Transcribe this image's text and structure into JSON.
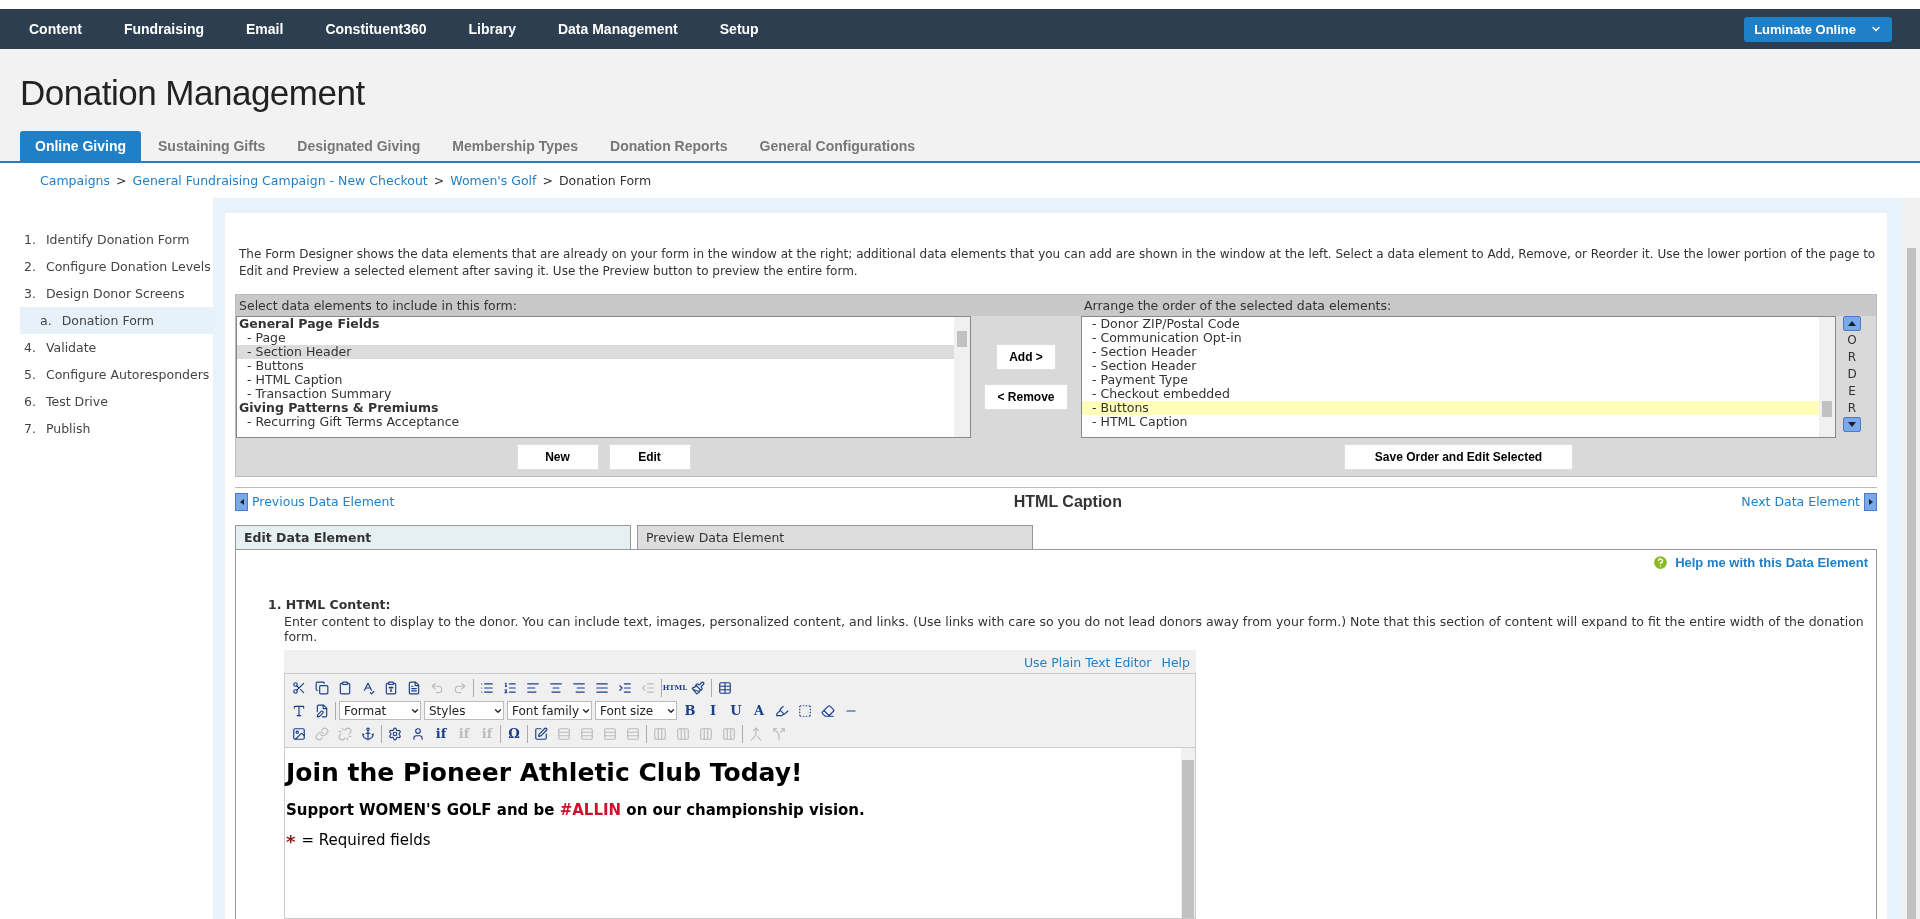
{
  "top_nav": {
    "items": [
      {
        "label": "Content"
      },
      {
        "label": "Fundraising"
      },
      {
        "label": "Email"
      },
      {
        "label": "Constituent360"
      },
      {
        "label": "Library"
      },
      {
        "label": "Data Management"
      },
      {
        "label": "Setup"
      }
    ],
    "product_button": "Luminate Online"
  },
  "page_title": "Donation Management",
  "tabs": [
    {
      "label": "Online Giving",
      "selected": true
    },
    {
      "label": "Sustaining Gifts",
      "selected": false
    },
    {
      "label": "Designated Giving",
      "selected": false
    },
    {
      "label": "Membership Types",
      "selected": false
    },
    {
      "label": "Donation Reports",
      "selected": false
    },
    {
      "label": "General Configurations",
      "selected": false
    }
  ],
  "breadcrumb": {
    "links": [
      "Campaigns",
      "General Fundraising Campaign - New Checkout",
      "Women's Golf"
    ],
    "separator": ">",
    "current": "Donation Form"
  },
  "steps": [
    {
      "number": "1.",
      "label": "Identify Donation Form",
      "selected": false
    },
    {
      "number": "2.",
      "label": "Configure Donation Levels",
      "selected": false
    },
    {
      "number": "3.",
      "label": "Design Donor Screens",
      "selected": false,
      "children": [
        {
          "number": "a.",
          "label": "Donation Form",
          "selected": true
        }
      ]
    },
    {
      "number": "4.",
      "label": "Validate",
      "selected": false
    },
    {
      "number": "5.",
      "label": "Configure Autoresponders",
      "selected": false
    },
    {
      "number": "6.",
      "label": "Test Drive",
      "selected": false
    },
    {
      "number": "7.",
      "label": "Publish",
      "selected": false
    }
  ],
  "intro": "The Form Designer shows the data elements that are already on your form in the window at the right; additional data elements that you can add are shown in the window at the left. Select a data element to Add, Remove, or Reorder it. Use the lower portion of the page to Edit and Preview a selected element after saving it. Use the Preview button to preview the entire form.",
  "available_list": {
    "heading": "Select data elements to include in this form:",
    "items": [
      {
        "kind": "group",
        "label": "General Page Fields",
        "selected": false
      },
      {
        "kind": "item",
        "label": "- Page",
        "selected": false
      },
      {
        "kind": "item",
        "label": "- Section Header",
        "selected": true
      },
      {
        "kind": "item",
        "label": "- Buttons",
        "selected": false
      },
      {
        "kind": "item",
        "label": "- HTML Caption",
        "selected": false
      },
      {
        "kind": "item",
        "label": "- Transaction Summary",
        "selected": false
      },
      {
        "kind": "group",
        "label": "Giving Patterns & Premiums",
        "selected": false
      },
      {
        "kind": "item",
        "label": "- Recurring Gift Terms Acceptance",
        "selected": false
      }
    ],
    "buttons": [
      "New",
      "Edit"
    ]
  },
  "move_buttons": [
    "Add >",
    "< Remove"
  ],
  "selected_list": {
    "heading": "Arrange the order of the selected data elements:",
    "items": [
      {
        "label": "- Donor ZIP/Postal Code",
        "selected": false
      },
      {
        "label": "- Communication Opt-in",
        "selected": false
      },
      {
        "label": "- Section Header",
        "selected": false
      },
      {
        "label": "- Section Header",
        "selected": false
      },
      {
        "label": "- Payment Type",
        "selected": false
      },
      {
        "label": "- Checkout embedded",
        "selected": false
      },
      {
        "label": "- Buttons",
        "selected": true
      },
      {
        "label": "- HTML Caption",
        "selected": false
      }
    ],
    "order_letters": [
      "O",
      "R",
      "D",
      "E",
      "R"
    ],
    "button": "Save Order and Edit Selected"
  },
  "element_nav": {
    "previous": "Previous Data Element",
    "title": "HTML Caption",
    "next": "Next Data Element"
  },
  "element_tabs": [
    {
      "label": "Edit Data Element",
      "selected": true
    },
    {
      "label": "Preview Data Element",
      "selected": false
    }
  ],
  "help_link": "Help me with this Data Element",
  "field": {
    "number": "1.",
    "label": "HTML Content:",
    "description": "Enter content to display to the donor. You can include text, images, personalized content, and links. (Use links with care so you do not lead donors away from your form.) Note that this section of content will expand to fit the entire width of the donation form."
  },
  "editor": {
    "links": [
      "Use Plain Text Editor",
      "Help"
    ],
    "toolbar": [
      [
        {
          "kind": "cut",
          "disabled": false
        },
        {
          "kind": "copy",
          "disabled": false
        },
        {
          "kind": "paste",
          "disabled": false
        },
        {
          "kind": "spell",
          "disabled": false
        },
        {
          "kind": "pastetext",
          "disabled": false
        },
        {
          "kind": "pasteword",
          "disabled": false
        },
        {
          "kind": "undo",
          "disabled": true
        },
        {
          "kind": "redo",
          "disabled": true
        },
        {
          "kind": "sep"
        },
        {
          "kind": "bullets",
          "disabled": false
        },
        {
          "kind": "numbers",
          "disabled": false
        },
        {
          "kind": "left",
          "disabled": false
        },
        {
          "kind": "center",
          "disabled": false
        },
        {
          "kind": "right",
          "disabled": false
        },
        {
          "kind": "justify",
          "disabled": false
        },
        {
          "kind": "indent",
          "disabled": false
        },
        {
          "kind": "outdent",
          "disabled": true
        },
        {
          "kind": "sep"
        },
        {
          "kind": "glyph",
          "label": "HTML",
          "disabled": false
        },
        {
          "kind": "brush",
          "disabled": false
        },
        {
          "kind": "sep"
        },
        {
          "kind": "table",
          "disabled": false
        }
      ],
      [
        {
          "kind": "styles",
          "disabled": false
        },
        {
          "kind": "template",
          "disabled": false
        },
        {
          "kind": "sep"
        },
        {
          "kind": "select",
          "label": "Format"
        },
        {
          "kind": "select",
          "label": "Styles"
        },
        {
          "kind": "select",
          "label": "Font family"
        },
        {
          "kind": "select",
          "label": "Font size"
        },
        {
          "kind": "glyph",
          "label": "B",
          "disabled": false
        },
        {
          "kind": "glyph",
          "label": "I",
          "disabled": false
        },
        {
          "kind": "glyph",
          "label": "U",
          "disabled": false
        },
        {
          "kind": "glyph",
          "label": "A",
          "disabled": false
        },
        {
          "kind": "highlight",
          "disabled": false
        },
        {
          "kind": "selectall",
          "disabled": false
        },
        {
          "kind": "eraser",
          "disabled": false
        },
        {
          "kind": "rule",
          "disabled": false
        }
      ],
      [
        {
          "kind": "image",
          "disabled": false
        },
        {
          "kind": "link",
          "disabled": true
        },
        {
          "kind": "unlink",
          "disabled": true
        },
        {
          "kind": "anchor",
          "disabled": false
        },
        {
          "kind": "sep"
        },
        {
          "kind": "gear",
          "disabled": false
        },
        {
          "kind": "person",
          "disabled": false
        },
        {
          "kind": "glyph",
          "label": "if",
          "disabled": false
        },
        {
          "kind": "glyph",
          "label": "if",
          "disabled": true
        },
        {
          "kind": "glyph",
          "label": "if",
          "disabled": true
        },
        {
          "kind": "sep"
        },
        {
          "kind": "glyph",
          "label": "Ω",
          "disabled": false
        },
        {
          "kind": "sep"
        },
        {
          "kind": "form",
          "disabled": false
        },
        {
          "kind": "grid",
          "disabled": true
        },
        {
          "kind": "grid",
          "disabled": true
        },
        {
          "kind": "grid",
          "disabled": true
        },
        {
          "kind": "grid",
          "disabled": true
        },
        {
          "kind": "sep"
        },
        {
          "kind": "cells",
          "disabled": true
        },
        {
          "kind": "cells",
          "disabled": true
        },
        {
          "kind": "cells",
          "disabled": true
        },
        {
          "kind": "cells",
          "disabled": true
        },
        {
          "kind": "sep"
        },
        {
          "kind": "merge",
          "disabled": true
        },
        {
          "kind": "split",
          "disabled": true
        }
      ]
    ],
    "content": {
      "heading": "Join the Pioneer Athletic Club Today!",
      "subheading_parts": [
        {
          "text": "Support WOMEN'S GOLF and be ",
          "accent": false
        },
        {
          "text": "#ALLIN",
          "accent": true
        },
        {
          "text": " on our championship vision.",
          "accent": false
        }
      ],
      "required_mark": "*",
      "required_text": "= Required fields"
    }
  }
}
